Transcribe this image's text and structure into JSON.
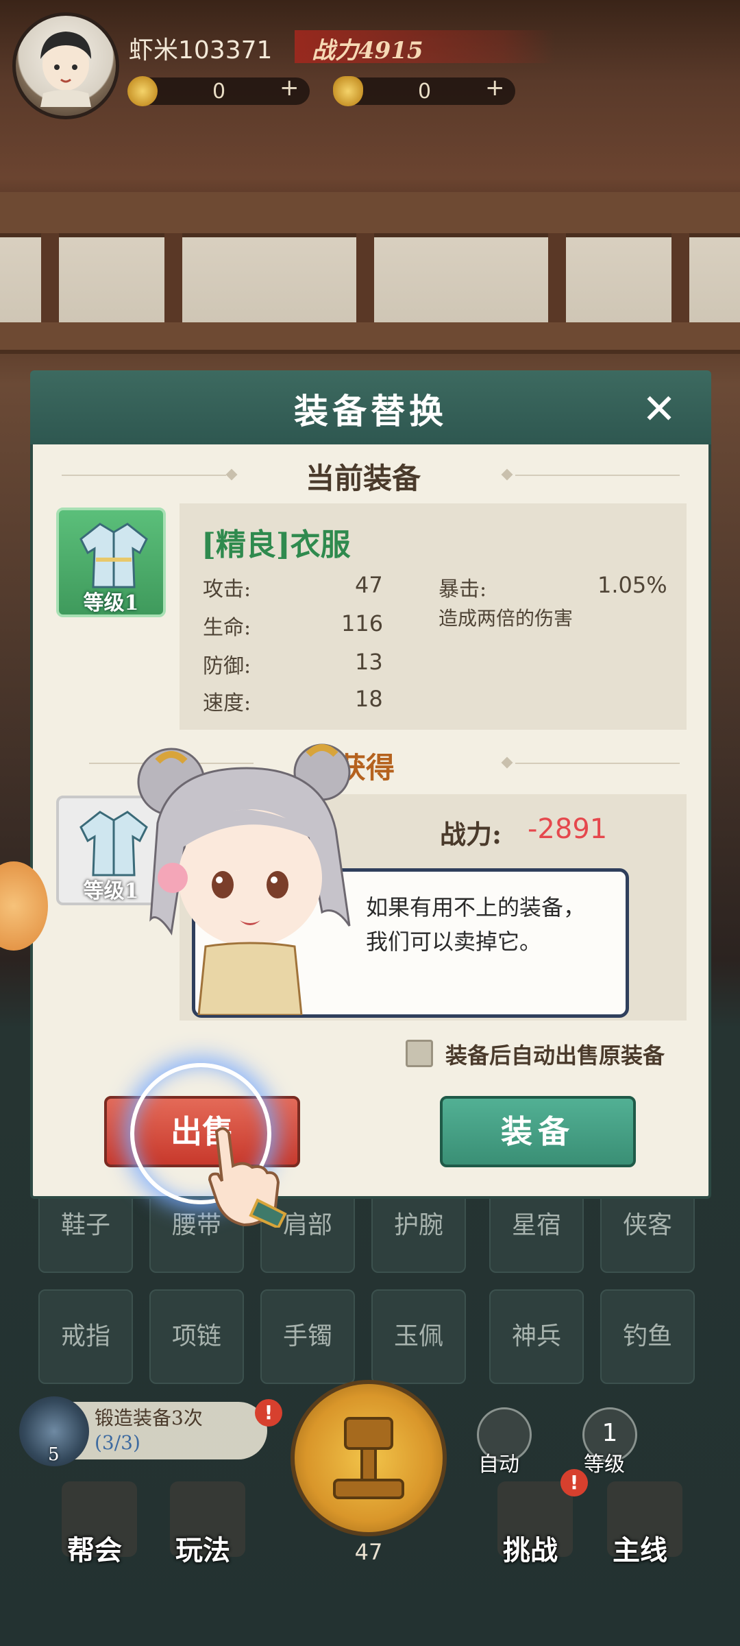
{
  "header": {
    "player_name": "虾米103371",
    "power_text": "战力4915",
    "gold_value": "0",
    "ingot_value": "0",
    "plus": "+"
  },
  "dialog": {
    "title": "装备替换",
    "close": "✕",
    "current_section": "当前装备",
    "new_section": "新获得",
    "current_item": {
      "name": "[精良]衣服",
      "level": "等级1",
      "stats": [
        {
          "label": "攻击:",
          "value": "47"
        },
        {
          "label": "生命:",
          "value": "116"
        },
        {
          "label": "防御:",
          "value": "13"
        },
        {
          "label": "速度:",
          "value": "18"
        }
      ],
      "crit_label": "暴击:",
      "crit_value": "1.05%",
      "crit_desc": "造成两倍的伤害"
    },
    "new_item": {
      "level": "等级1",
      "power_label": "战力:",
      "power_value": "-2891"
    },
    "bubble_line1": "如果有用不上的装备，",
    "bubble_line2": "我们可以卖掉它。",
    "auto_sell_label": "装备后自动出售原装备",
    "sell_button": "出售",
    "equip_button": "装备"
  },
  "slots": [
    "鞋子",
    "腰带",
    "肩部",
    "护腕",
    "星宿",
    "侠客",
    "戒指",
    "项链",
    "手镯",
    "玉佩",
    "神兵",
    "钓鱼"
  ],
  "bottom": {
    "forge_line1": "锻造装备3次",
    "forge_line2": "(3/3)",
    "forge_count": "5",
    "auto_label": "自动",
    "level_num": "1",
    "level_label": "等级",
    "center_num": "47",
    "badge": "!",
    "nav": [
      "帮会",
      "玩法",
      "挑战",
      "主线"
    ]
  },
  "colors": {
    "dialog_header": "#2e5750",
    "sell": "#c8392c",
    "equip": "#3a8f75",
    "item_green": "#3f9a5c",
    "power_negative": "#e5484d"
  }
}
